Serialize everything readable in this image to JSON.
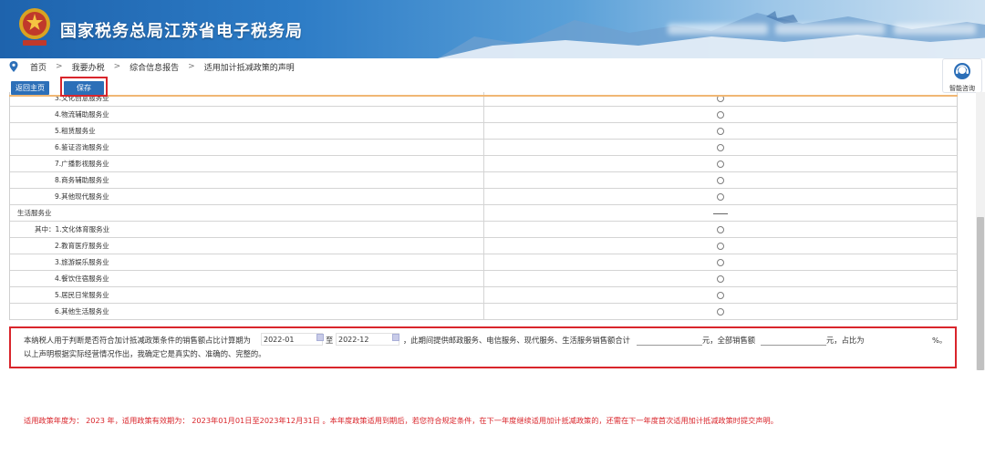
{
  "header": {
    "site_title": "国家税务总局江苏省电子税务局",
    "emblem_motto": "中国税务"
  },
  "breadcrumb": [
    "首页",
    "我要办税",
    "综合信息报告",
    "适用加计抵减政策的声明"
  ],
  "toolbar": {
    "home_label": "返回主页",
    "save_label": "保存"
  },
  "consult": {
    "label": "智能咨询"
  },
  "table": {
    "rows": [
      {
        "label": "3.文化创意服务业",
        "mark": "radio",
        "indent": 3
      },
      {
        "label": "4.物流辅助服务业",
        "mark": "radio",
        "indent": 3
      },
      {
        "label": "5.租赁服务业",
        "mark": "radio",
        "indent": 3
      },
      {
        "label": "6.鉴证咨询服务业",
        "mark": "radio",
        "indent": 3
      },
      {
        "label": "7.广播影视服务业",
        "mark": "radio",
        "indent": 3
      },
      {
        "label": "8.商务辅助服务业",
        "mark": "radio",
        "indent": 3
      },
      {
        "label": "9.其他现代服务业",
        "mark": "radio",
        "indent": 3
      },
      {
        "label": "生活服务业",
        "mark": "dash",
        "indent": 1
      },
      {
        "label": "其中：1.文化体育服务业",
        "mark": "radio",
        "indent": 2
      },
      {
        "label": "2.教育医疗服务业",
        "mark": "radio",
        "indent": 3
      },
      {
        "label": "3.旅游娱乐服务业",
        "mark": "radio",
        "indent": 3
      },
      {
        "label": "4.餐饮住宿服务业",
        "mark": "radio",
        "indent": 3
      },
      {
        "label": "5.居民日常服务业",
        "mark": "radio",
        "indent": 3
      },
      {
        "label": "6.其他生活服务业",
        "mark": "radio",
        "indent": 3
      }
    ]
  },
  "declaration": {
    "text_a": "本纳税人用于判断是否符合加计抵减政策条件的销售额占比计算期为",
    "start_period": "2022-01",
    "to": "至",
    "end_period": "2022-12",
    "text_b": "，此期间提供邮政服务、电信服务、现代服务、生活服务销售额合计",
    "unit_yuan_1": "元，全部销售额",
    "unit_yuan_2": "元，占比为",
    "percent": "%。",
    "line2": "以上声明根据实际经营情况作出，我确定它是真实的、准确的、完整的。"
  },
  "notice": "适用政策年度为： 2023  年，适用政策有效期为： 2023年01月01日至2023年12月31日 。本年度政策适用到期后，若您符合规定条件，在下一年度继续适用加计抵减政策的，还需在下一年度首次适用加计抵减政策时提交声明。",
  "colors": {
    "primary_blue": "#2c6fb8",
    "highlight_red": "#d9252b",
    "notice_red": "#d9252b"
  }
}
